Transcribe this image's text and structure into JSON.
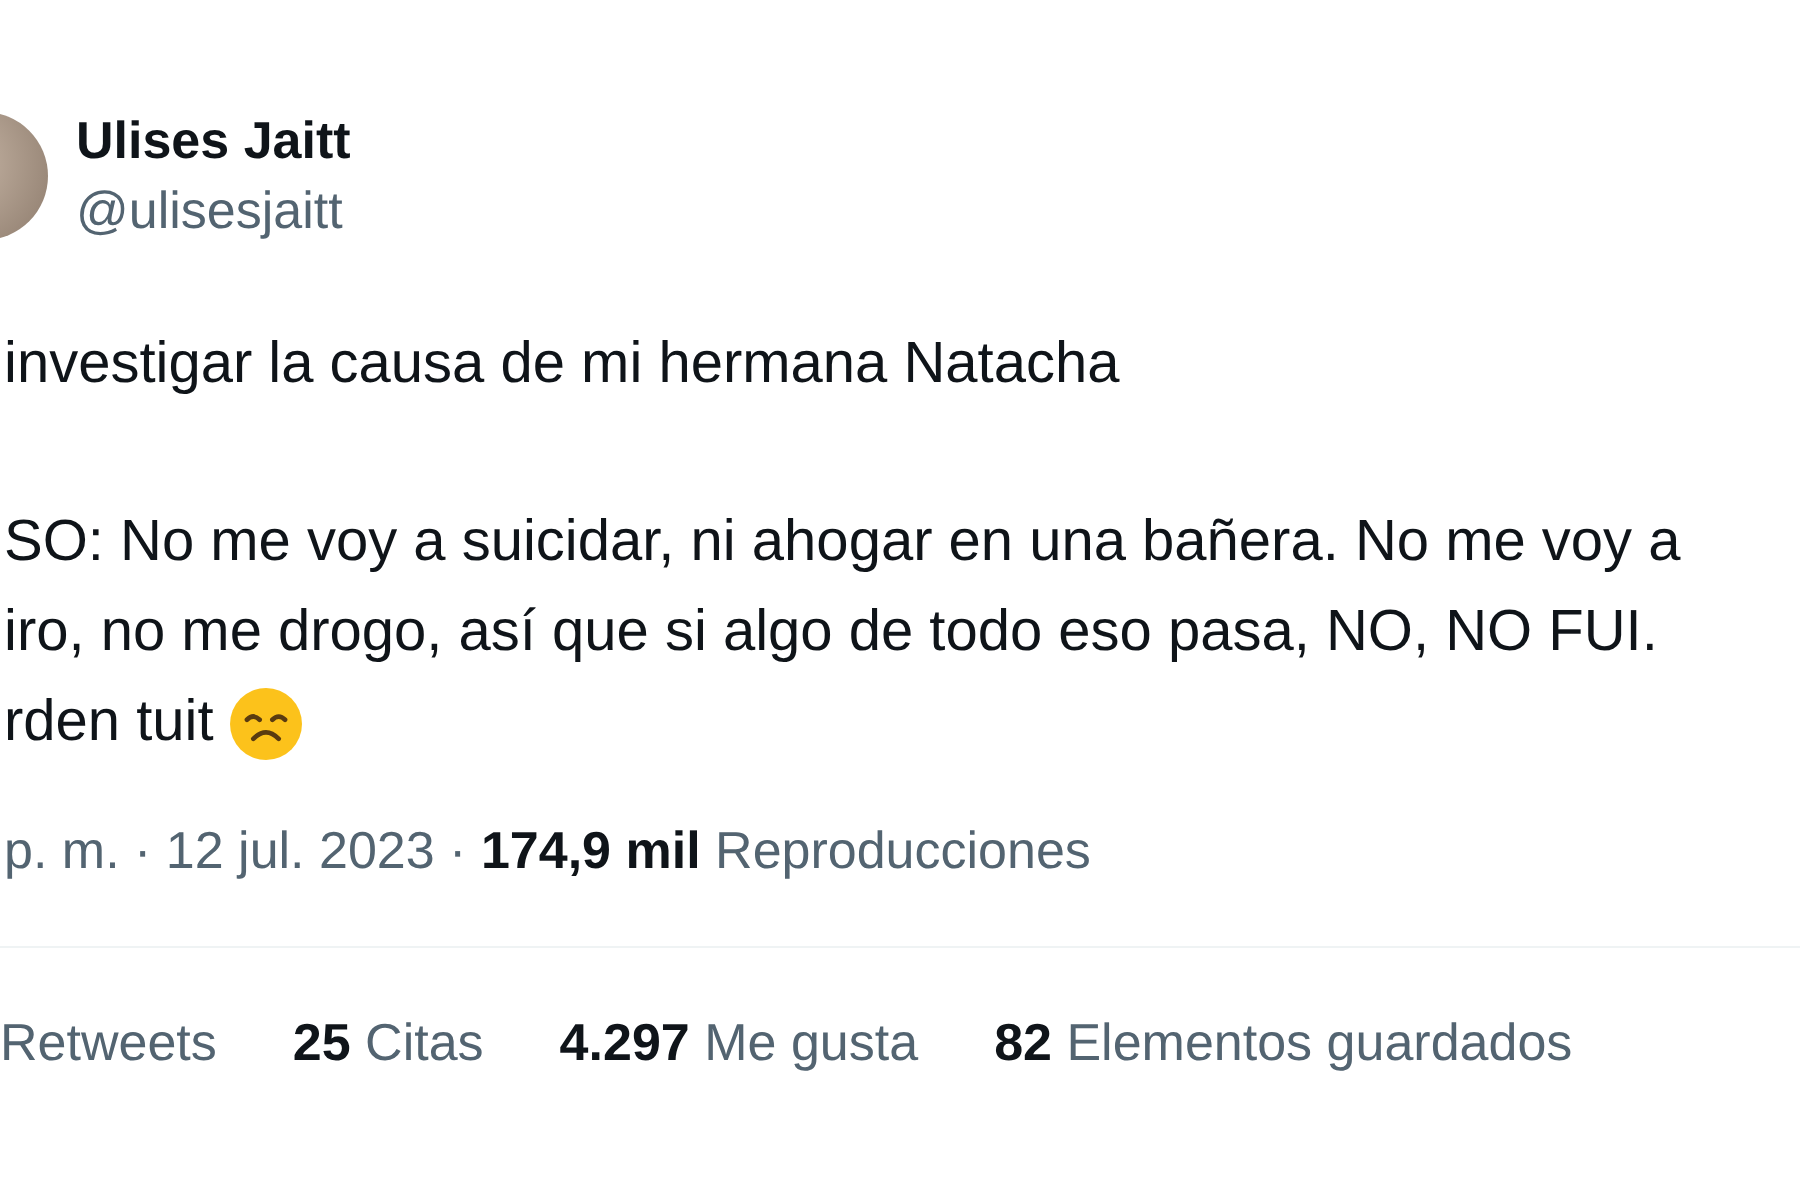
{
  "author": {
    "name": "Ulises Jaitt",
    "handle": "@ulisesjaitt"
  },
  "paragraphs": [
    {
      "lines": [
        "investigar la causa de mi hermana Natacha"
      ]
    },
    {
      "lines": [
        "SO: No me voy a suicidar, ni ahogar en una bañera. No me voy a",
        "iro, no me drogo, así que si algo de todo eso pasa, NO, NO FUI.",
        "rden tuit"
      ]
    }
  ],
  "meta": "p. m. · 12 jul. 2023 · **174,9 mil** Reproducciones",
  "stats": [
    {
      "label": "Retweets"
    },
    {
      "count": "25",
      "label": "Citas"
    },
    {
      "count": "4.297",
      "label": "Me gusta"
    },
    {
      "count": "82",
      "label": "Elementos guardados"
    }
  ]
}
